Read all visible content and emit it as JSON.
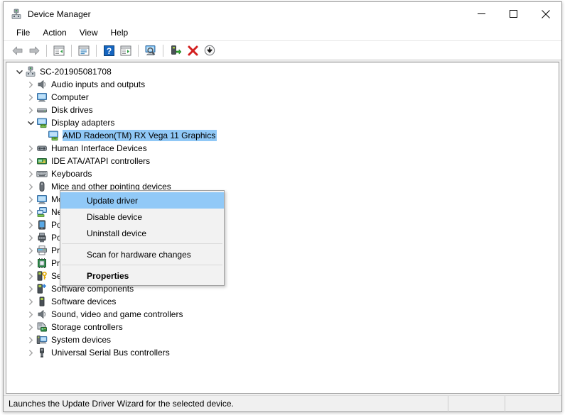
{
  "window": {
    "title": "Device Manager",
    "title_icon": "device-manager-icon",
    "controls": {
      "minimize": "minimize-icon",
      "maximize": "maximize-icon",
      "close": "close-icon"
    }
  },
  "menubar": {
    "items": [
      {
        "label": "File"
      },
      {
        "label": "Action"
      },
      {
        "label": "View"
      },
      {
        "label": "Help"
      }
    ]
  },
  "toolbar": {
    "items": [
      {
        "name": "back-icon",
        "type": "button"
      },
      {
        "name": "forward-icon",
        "type": "button"
      },
      {
        "name": "separator",
        "type": "sep"
      },
      {
        "name": "show-hide-console-tree-icon",
        "type": "button"
      },
      {
        "name": "separator",
        "type": "sep"
      },
      {
        "name": "properties-icon",
        "type": "button"
      },
      {
        "name": "separator",
        "type": "sep"
      },
      {
        "name": "help-icon",
        "type": "button"
      },
      {
        "name": "show-action-pane-icon",
        "type": "button"
      },
      {
        "name": "separator",
        "type": "sep"
      },
      {
        "name": "scan-for-hardware-changes-icon",
        "type": "button"
      },
      {
        "name": "separator",
        "type": "sep"
      },
      {
        "name": "update-driver-icon",
        "type": "button"
      },
      {
        "name": "uninstall-device-icon",
        "type": "button"
      },
      {
        "name": "disable-device-icon",
        "type": "button"
      }
    ]
  },
  "tree": {
    "rows": [
      {
        "label": "SC-201905081708",
        "indent": 0,
        "chevron": "down",
        "icon": "computer-root-icon",
        "selected": false
      },
      {
        "label": "Audio inputs and outputs",
        "indent": 1,
        "chevron": "right",
        "icon": "speaker-icon",
        "selected": false
      },
      {
        "label": "Computer",
        "indent": 1,
        "chevron": "right",
        "icon": "monitor-icon",
        "selected": false
      },
      {
        "label": "Disk drives",
        "indent": 1,
        "chevron": "right",
        "icon": "disk-drive-icon",
        "selected": false
      },
      {
        "label": "Display adapters",
        "indent": 1,
        "chevron": "down",
        "icon": "display-adapter-icon",
        "selected": false
      },
      {
        "label": "AMD Radeon(TM) RX Vega 11 Graphics",
        "indent": 2,
        "chevron": "none",
        "icon": "display-adapter-icon",
        "selected": true
      },
      {
        "label": "Human Interface Devices",
        "indent": 1,
        "chevron": "right",
        "icon": "hid-icon",
        "selected": false
      },
      {
        "label": "IDE ATA/ATAPI controllers",
        "indent": 1,
        "chevron": "right",
        "icon": "ide-controller-icon",
        "selected": false
      },
      {
        "label": "Keyboards",
        "indent": 1,
        "chevron": "right",
        "icon": "keyboard-icon",
        "selected": false
      },
      {
        "label": "Mice and other pointing devices",
        "indent": 1,
        "chevron": "right",
        "icon": "mouse-icon",
        "selected": false
      },
      {
        "label": "Monitors",
        "indent": 1,
        "chevron": "right",
        "icon": "monitor-icon",
        "selected": false
      },
      {
        "label": "Network adapters",
        "indent": 1,
        "chevron": "right",
        "icon": "network-adapter-icon",
        "selected": false
      },
      {
        "label": "Portable Devices",
        "indent": 1,
        "chevron": "right",
        "icon": "portable-device-icon",
        "selected": false
      },
      {
        "label": "Ports (COM & LPT)",
        "indent": 1,
        "chevron": "right",
        "icon": "port-icon",
        "selected": false
      },
      {
        "label": "Print queues",
        "indent": 1,
        "chevron": "right",
        "icon": "printer-icon",
        "selected": false
      },
      {
        "label": "Processors",
        "indent": 1,
        "chevron": "right",
        "icon": "processor-icon",
        "selected": false
      },
      {
        "label": "Security devices",
        "indent": 1,
        "chevron": "right",
        "icon": "security-device-icon",
        "selected": false
      },
      {
        "label": "Software components",
        "indent": 1,
        "chevron": "right",
        "icon": "software-component-icon",
        "selected": false
      },
      {
        "label": "Software devices",
        "indent": 1,
        "chevron": "right",
        "icon": "software-device-icon",
        "selected": false
      },
      {
        "label": "Sound, video and game controllers",
        "indent": 1,
        "chevron": "right",
        "icon": "speaker-icon",
        "selected": false
      },
      {
        "label": "Storage controllers",
        "indent": 1,
        "chevron": "right",
        "icon": "storage-controller-icon",
        "selected": false
      },
      {
        "label": "System devices",
        "indent": 1,
        "chevron": "right",
        "icon": "system-device-icon",
        "selected": false
      },
      {
        "label": "Universal Serial Bus controllers",
        "indent": 1,
        "chevron": "right",
        "icon": "usb-icon",
        "selected": false
      }
    ]
  },
  "context_menu": {
    "items": [
      {
        "label": "Update driver",
        "type": "item",
        "highlighted": true,
        "bold": false
      },
      {
        "label": "Disable device",
        "type": "item",
        "highlighted": false,
        "bold": false
      },
      {
        "label": "Uninstall device",
        "type": "item",
        "highlighted": false,
        "bold": false
      },
      {
        "label": "",
        "type": "separator"
      },
      {
        "label": "Scan for hardware changes",
        "type": "item",
        "highlighted": false,
        "bold": false
      },
      {
        "label": "",
        "type": "separator"
      },
      {
        "label": "Properties",
        "type": "item",
        "highlighted": false,
        "bold": true
      }
    ]
  },
  "statusbar": {
    "text": "Launches the Update Driver Wizard for the selected device.",
    "panes": 2
  },
  "colors": {
    "selection": "#90c8f6",
    "menu_highlight": "#91c9f7",
    "window_bg": "#f0f0f0",
    "panel_bg": "#ffffff"
  }
}
